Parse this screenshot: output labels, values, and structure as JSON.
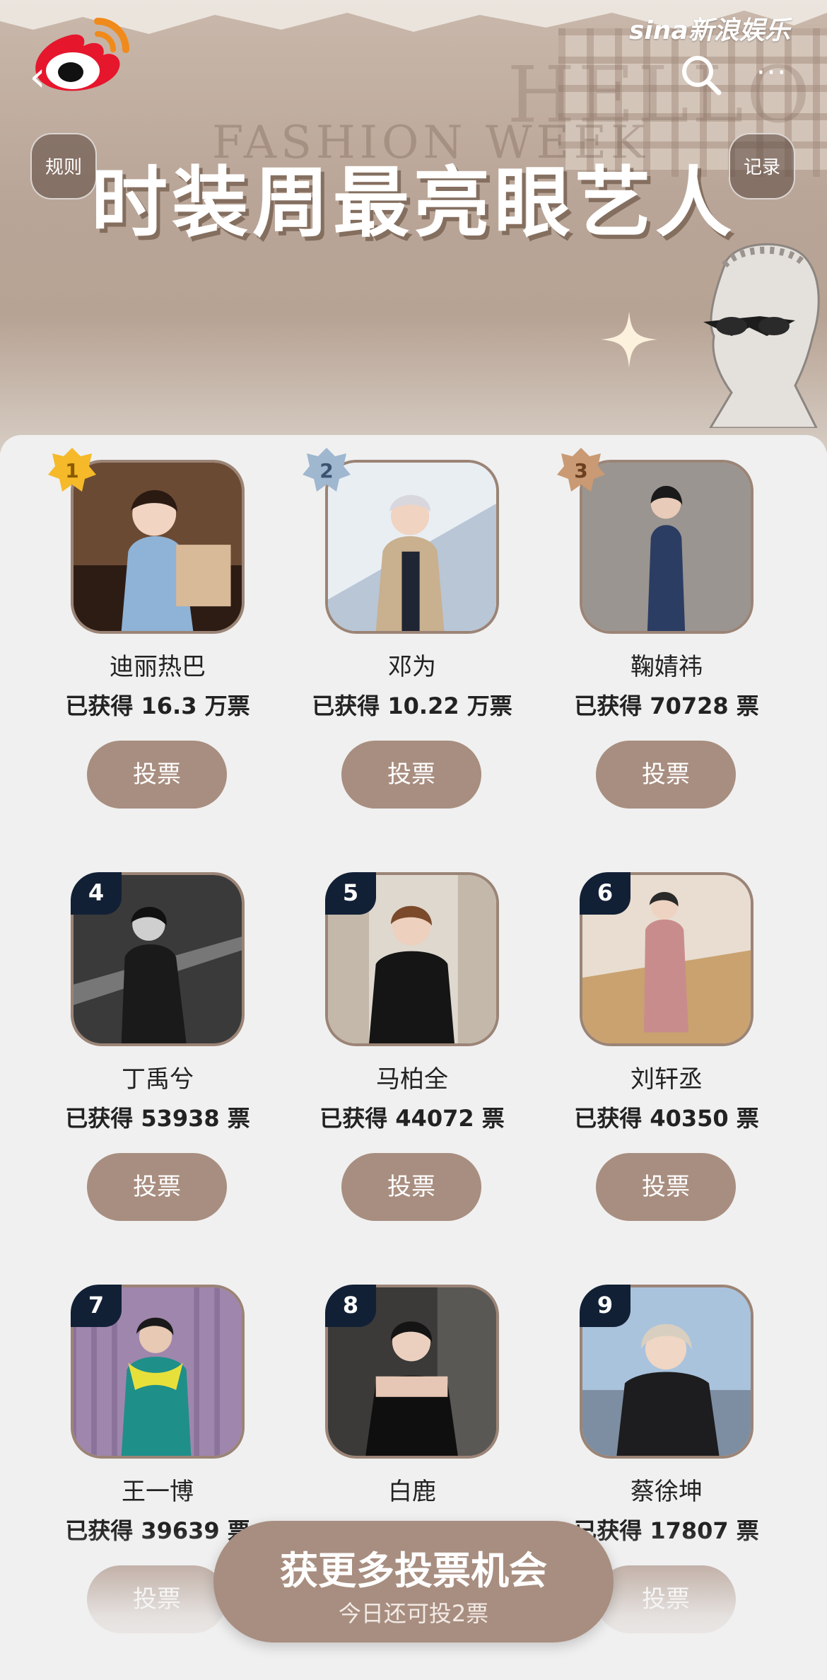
{
  "header": {
    "brand": "sina新浪娱乐",
    "title": "时装周最亮眼艺人",
    "bg_text_1": "HELLO",
    "bg_text_2": "FASHION WEEK",
    "rules_label": "规则",
    "records_label": "记录"
  },
  "colors": {
    "accent": "#a88e80",
    "rank_badge": "#122036",
    "gold": "#f5b92a",
    "silver": "#9fb7cf",
    "bronze": "#c99a73"
  },
  "artists": [
    {
      "rank": "1",
      "name": "迪丽热巴",
      "votes": "已获得 16.3 万票",
      "vote_label": "投票"
    },
    {
      "rank": "2",
      "name": "邓为",
      "votes": "已获得 10.22 万票",
      "vote_label": "投票"
    },
    {
      "rank": "3",
      "name": "鞠婧祎",
      "votes": "已获得 70728 票",
      "vote_label": "投票"
    },
    {
      "rank": "4",
      "name": "丁禹兮",
      "votes": "已获得 53938 票",
      "vote_label": "投票"
    },
    {
      "rank": "5",
      "name": "马柏全",
      "votes": "已获得 44072 票",
      "vote_label": "投票"
    },
    {
      "rank": "6",
      "name": "刘轩丞",
      "votes": "已获得 40350 票",
      "vote_label": "投票"
    },
    {
      "rank": "7",
      "name": "王一博",
      "votes": "已获得 39639 票",
      "vote_label": "投票"
    },
    {
      "rank": "8",
      "name": "白鹿",
      "votes": "",
      "vote_label": "投票"
    },
    {
      "rank": "9",
      "name": "蔡徐坤",
      "votes": "已获得 17807 票",
      "vote_label": "投票"
    }
  ],
  "cta": {
    "title": "获更多投票机会",
    "subtitle": "今日还可投2票"
  }
}
